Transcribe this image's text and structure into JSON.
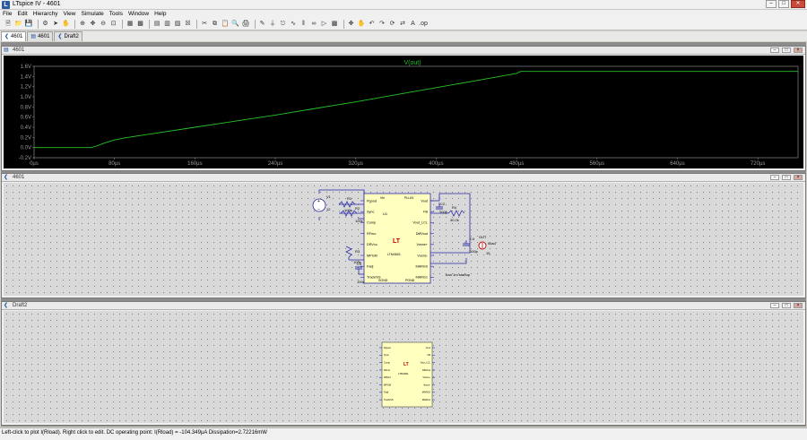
{
  "window": {
    "title": "LTspice IV - 4601"
  },
  "menu": [
    "File",
    "Edit",
    "Hierarchy",
    "View",
    "Simulate",
    "Tools",
    "Window",
    "Help"
  ],
  "tabs": [
    {
      "label": "4601",
      "icon": "waveform-icon"
    },
    {
      "label": "4601",
      "icon": "schematic-icon"
    },
    {
      "label": "Draft2",
      "icon": "schematic-icon"
    }
  ],
  "plot_window": {
    "title": "4601",
    "trace_label": "V(out)"
  },
  "schematic_window": {
    "title": "4601",
    "chip": {
      "designator": "U1",
      "part": "LTM4601",
      "logo": "LT",
      "left_pins": [
        "Pgood",
        "Sync",
        "Comp",
        "RFmo",
        "DRVcc",
        "MPGM",
        "Fadj",
        "Track/SS"
      ],
      "right_pins": [
        "Vout",
        "FB",
        "Vout_LCL",
        "DiffVout",
        "Vosns+",
        "Vosns-",
        "MARG0",
        "MARG1"
      ],
      "top_pins": [
        "Vin",
        "PLLIN"
      ],
      "bottom_pins": [
        "SGND",
        "PGND"
      ]
    },
    "components": {
      "source": {
        "ref": "V1",
        "value": "12"
      },
      "r1": {
        "ref": "R1",
        "value": "100k"
      },
      "r2": {
        "ref": "R2",
        "value": "100k"
      },
      "r3": {
        "ref": "R3",
        "value": "100k"
      },
      "c1": {
        "ref": "C1",
        "value": "10u"
      },
      "c2": {
        "ref": "C2",
        "value": "100p"
      },
      "c3": {
        "ref": "C3",
        "value": "100p"
      },
      "rfb": {
        "ref": "R4",
        "value": "40.2k"
      },
      "cout": {
        "ref": "C4",
        "value": "100p"
      },
      "load": {
        "ref": "Iload",
        "value": "15"
      },
      "out_label": "OUT"
    },
    "annotation": ".tran 1m startup"
  },
  "draft_window": {
    "title": "Draft2"
  },
  "status": {
    "text": "Left-click to plot I(Rload).  Right click to edit.  DC operating point: I(Rload) = -104.349µA   Dissipation=2.72216mW"
  },
  "chart_data": {
    "type": "line",
    "title": "V(out)",
    "xlabel": "",
    "ylabel": "",
    "x_ticks": [
      "0µs",
      "80µs",
      "160µs",
      "240µs",
      "320µs",
      "400µs",
      "480µs",
      "560µs",
      "640µs",
      "720µs"
    ],
    "y_ticks": [
      "1.6V",
      "1.4V",
      "1.2V",
      "1.0V",
      "0.8V",
      "0.6V",
      "0.4V",
      "0.2V",
      "0.0V",
      "-0.2V"
    ],
    "xlim": [
      0,
      760
    ],
    "ylim": [
      -0.2,
      1.6
    ],
    "grid": false,
    "series": [
      {
        "name": "V(out)",
        "color": "#27c427",
        "x": [
          0,
          57,
          62,
          70,
          80,
          90,
          100,
          120,
          160,
          200,
          240,
          280,
          320,
          360,
          400,
          440,
          480,
          484,
          520,
          560,
          600,
          640,
          680,
          760
        ],
        "y": [
          0.0,
          0.0,
          0.03,
          0.09,
          0.15,
          0.19,
          0.22,
          0.28,
          0.4,
          0.52,
          0.64,
          0.77,
          0.9,
          1.04,
          1.18,
          1.32,
          1.46,
          1.5,
          1.5,
          1.5,
          1.5,
          1.5,
          1.5,
          1.5
        ]
      }
    ]
  }
}
